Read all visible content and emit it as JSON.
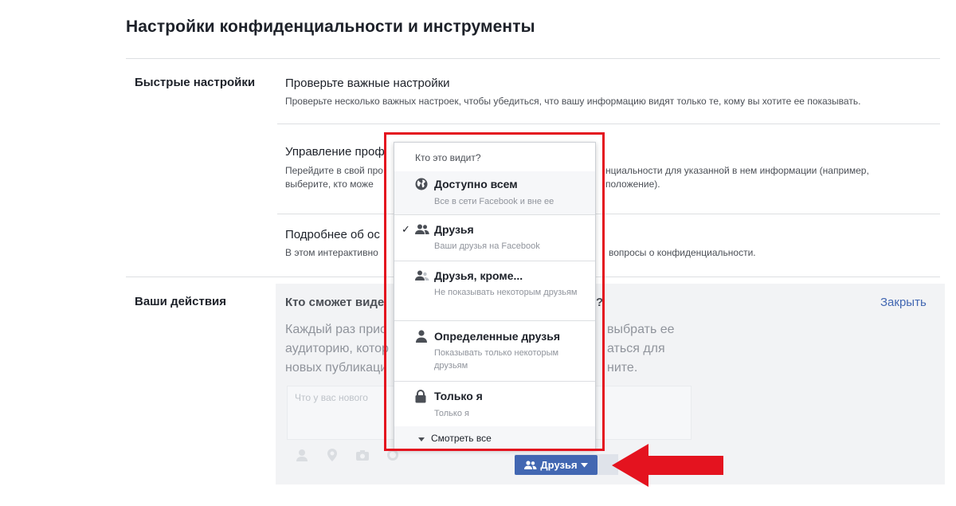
{
  "page": {
    "title": "Настройки конфиденциальности и инструменты"
  },
  "quick_settings": {
    "label": "Быстрые настройки",
    "items": [
      {
        "title": "Проверьте важные настройки",
        "desc": "Проверьте несколько важных настроек, чтобы убедиться, что вашу информацию видят только те, кому вы хотите ее показывать."
      },
      {
        "title": "Управление проф",
        "desc_line1_left": "Перейдите в свой про",
        "desc_line1_right": "нциальности для указанной в нем информации (например,",
        "desc_line2_left": "выберите, кто може",
        "desc_line2_right": "положение)."
      },
      {
        "title": "Подробнее об ос",
        "desc_left": "В этом интерактивно",
        "desc_right": "вопросы о конфиденциальности."
      }
    ]
  },
  "actions": {
    "label": "Ваши действия",
    "title": "Кто сможет виде",
    "title_tail": "?",
    "close": "Закрыть",
    "desc_left": [
      "Каждый раз прис",
      "аудиторию, котор",
      "новых публикаци"
    ],
    "desc_right": [
      "выбрать ее",
      "аться для",
      "ните."
    ],
    "composer_placeholder": "Что у вас нового",
    "friends_button": "Друзья"
  },
  "dropdown": {
    "header": "Кто это видит?",
    "options": [
      {
        "icon": "globe-icon",
        "title": "Доступно всем",
        "subtitle": "Все в сети Facebook и вне ее",
        "selected": false
      },
      {
        "icon": "friends-icon",
        "title": "Друзья",
        "subtitle": "Ваши друзья на Facebook",
        "selected": true
      },
      {
        "icon": "friends-except-icon",
        "title": "Друзья, кроме...",
        "subtitle": "Не показывать некоторым друзьям",
        "selected": false
      },
      {
        "icon": "person-icon",
        "title": "Определенные друзья",
        "subtitle": "Показывать только некоторым друзьям",
        "selected": false
      },
      {
        "icon": "lock-icon",
        "title": "Только я",
        "subtitle": "Только я",
        "selected": false
      }
    ],
    "see_all": "Смотреть все",
    "check_mark": "✓"
  },
  "colors": {
    "accent_blue": "#4267b2",
    "highlight_red": "#e4131f",
    "arrow_red": "#e4131f"
  }
}
